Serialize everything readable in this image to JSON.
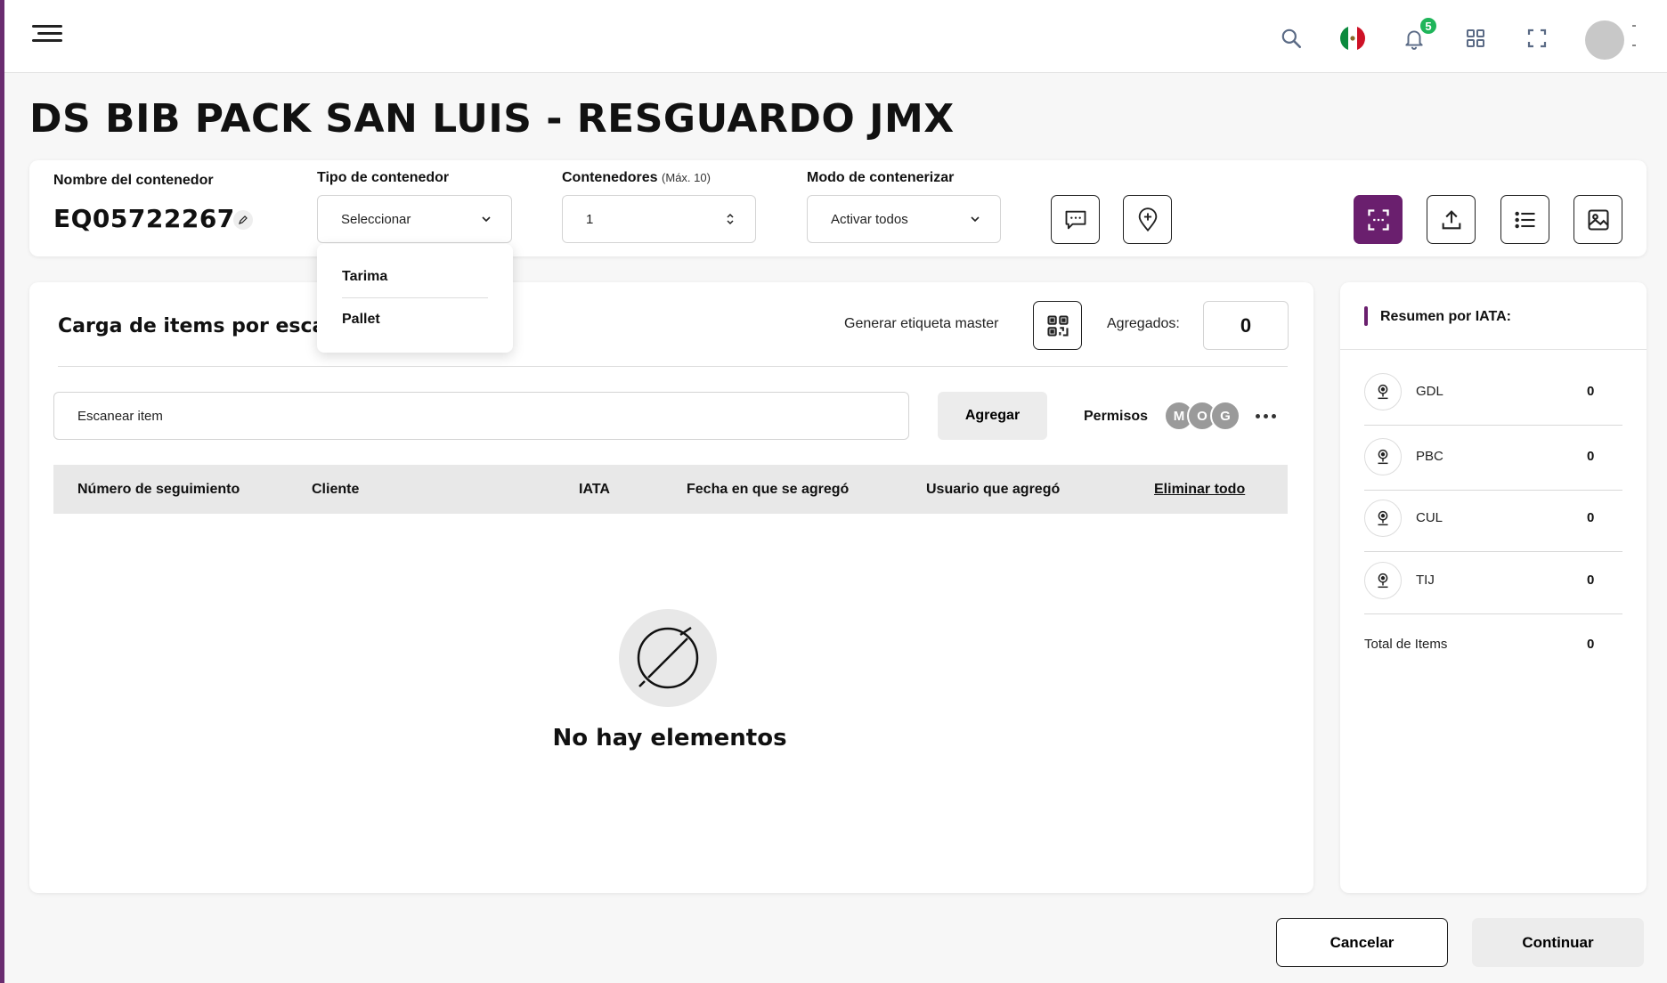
{
  "page": {
    "title": "DS BIB PACK SAN LUIS - RESGUARDO JMX"
  },
  "topbar": {
    "notifications_count": "5",
    "icons": [
      "menu-icon",
      "search-icon",
      "mexico-flag-icon",
      "bell-icon",
      "apps-grid-icon",
      "fullscreen-icon",
      "avatar"
    ]
  },
  "filters": {
    "container_name_label": "Nombre del contenedor",
    "container_name_value": "EQ05722267",
    "container_type_label": "Tipo de contenedor",
    "container_type_value": "Seleccionar",
    "container_type_options": [
      "Tarima",
      "Pallet"
    ],
    "containers_label": "Contenedores",
    "containers_hint": "(Máx. 10)",
    "containers_value": "1",
    "mode_label": "Modo de contenerizar",
    "mode_value": "Activar todos"
  },
  "main": {
    "section_title": "Carga de items por escaneo",
    "generate_label": "Generar etiqueta master",
    "added_label": "Agregados:",
    "added_value": "0",
    "scan_placeholder": "Escanear item",
    "add_button": "Agregar",
    "permissions_label": "Permisos",
    "permission_avatars": [
      "M",
      "O",
      "G"
    ],
    "table_headers": [
      "Número de seguimiento",
      "Cliente",
      "IATA",
      "Fecha en que se agregó",
      "Usuario que agregó"
    ],
    "delete_all": "Eliminar todo",
    "empty_text": "No hay elementos"
  },
  "summary": {
    "title": "Resumen por IATA:",
    "rows": [
      {
        "code": "GDL",
        "value": "0"
      },
      {
        "code": "PBC",
        "value": "0"
      },
      {
        "code": "CUL",
        "value": "0"
      },
      {
        "code": "TIJ",
        "value": "0"
      }
    ],
    "total_label": "Total de Items",
    "total_value": "0"
  },
  "footer": {
    "cancel": "Cancelar",
    "continue": "Continuar"
  },
  "colors": {
    "accent": "#6a1f6e",
    "badge": "#1fb55a"
  }
}
